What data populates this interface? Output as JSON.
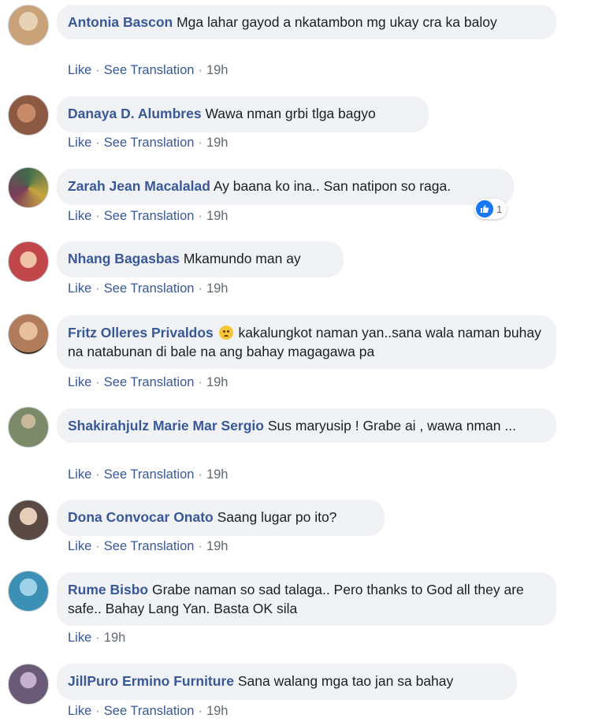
{
  "ui": {
    "like_label": "Like",
    "translate_label": "See Translation",
    "separator": "·"
  },
  "comments": [
    {
      "author": "Antonia Bascon",
      "text": "Mga lahar gayod a nkatambon mg ukay cra ka baloy",
      "time": "19h",
      "avatar_color": "#c9a27a"
    },
    {
      "author": "Danaya D. Alumbres",
      "text": "Wawa nman grbi tlga bagyo",
      "time": "19h",
      "avatar_color": "#8c5a42"
    },
    {
      "author": "Zarah Jean Macalalad",
      "text": "Ay baana ko ina.. San natipon so raga.",
      "time": "19h",
      "avatar_color": "#3f6b4a",
      "reaction_count": "1"
    },
    {
      "author": "Nhang Bagasbas",
      "text": "Mkamundo man ay",
      "time": "19h",
      "avatar_color": "#c2474a"
    },
    {
      "author": "Fritz Olleres Privaldos",
      "text": "kakalungkot naman yan..sana wala naman buhay na natabunan di bale na ang bahay magagawa pa",
      "time": "19h",
      "avatar_color": "#b07c5c"
    },
    {
      "author": "Shakirahjulz Marie Mar Sergio",
      "text": "Sus maryusip ! Grabe ai , wawa nman ...",
      "time": "19h",
      "avatar_color": "#7d8a6a"
    },
    {
      "author": "Dona Convocar Onato",
      "text": "Saang lugar po ito?",
      "time": "19h",
      "avatar_color": "#5b4a44"
    },
    {
      "author": "Rume Bisbo",
      "text": "Grabe naman so sad talaga.. Pero thanks to God all they are safe.. Bahay Lang Yan. Basta OK sila",
      "time": "19h",
      "avatar_color": "#3c8fb5"
    },
    {
      "author": "JillPuro Ermino Furniture",
      "text": "Sana walang mga tao jan sa bahay",
      "time": "19h",
      "avatar_color": "#6a5a78"
    }
  ]
}
